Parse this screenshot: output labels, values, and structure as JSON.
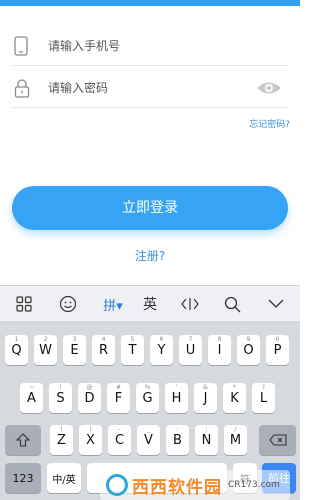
{
  "form": {
    "phone_placeholder": "请输入手机号",
    "password_placeholder": "请输入密码",
    "forgot_label": "忘记密码?",
    "login_label": "立即登录",
    "register_label": "注册?"
  },
  "keyboard": {
    "toolbar": {
      "pinyin": "拼▾",
      "english": "英"
    },
    "row1": [
      "Q",
      "W",
      "E",
      "R",
      "T",
      "Y",
      "U",
      "I",
      "O",
      "P"
    ],
    "row1_sub": [
      "1",
      "2",
      "3",
      "4",
      "5",
      "6",
      "7",
      "8",
      "9",
      "0"
    ],
    "row2": [
      "A",
      "S",
      "D",
      "F",
      "G",
      "H",
      "J",
      "K",
      "L"
    ],
    "row2_sub": [
      "~",
      "!",
      "@",
      "#",
      "%",
      "'",
      "&",
      "*",
      "?"
    ],
    "row3": [
      "Z",
      "X",
      "C",
      "V",
      "B",
      "N",
      "M"
    ],
    "row3_sub": [
      "(",
      ")",
      "-",
      "_",
      ":",
      ";",
      "/"
    ],
    "num_label": "123",
    "lang_label": "中/英",
    "symbol_label": "符",
    "go_label": "前往"
  },
  "watermark": {
    "title": "西西软件园",
    "subtitle": "CR173.com"
  },
  "colors": {
    "accent": "#36a3f4",
    "link": "#3a8fd8",
    "go_key": "#3b86f5"
  }
}
